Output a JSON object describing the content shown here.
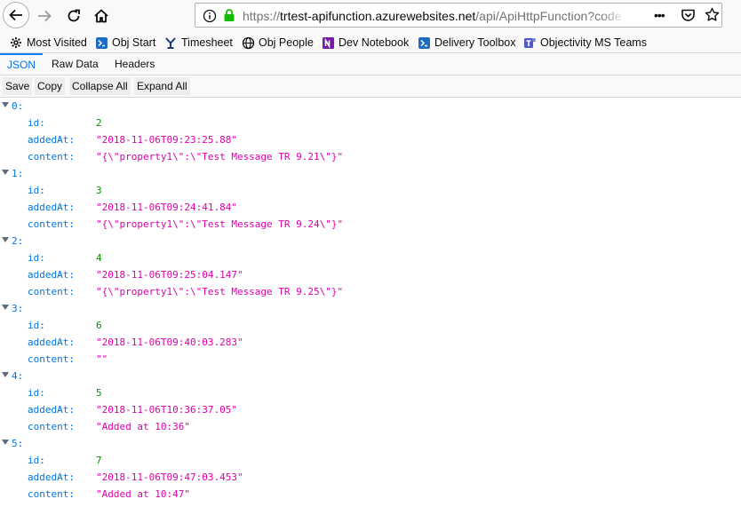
{
  "browser": {
    "url_scheme": "https://",
    "url_host": "trtest-apifunction.azurewebsites.net",
    "url_path": "/api/ApiHttpFunction?code",
    "url_menu": "•••"
  },
  "bookmarks": [
    {
      "label": "Most Visited",
      "icon": "gear-icon"
    },
    {
      "label": "Obj Start",
      "icon": "obj-start-icon"
    },
    {
      "label": "Timesheet",
      "icon": "timesheet-icon"
    },
    {
      "label": "Obj People",
      "icon": "globe-icon"
    },
    {
      "label": "Dev Notebook",
      "icon": "onenote-icon"
    },
    {
      "label": "Delivery Toolbox",
      "icon": "obj-start-icon"
    },
    {
      "label": "Objectivity MS Teams",
      "icon": "teams-icon"
    }
  ],
  "viewer": {
    "tabs": [
      "JSON",
      "Raw Data",
      "Headers"
    ],
    "toolbar": [
      "Save",
      "Copy",
      "Collapse All",
      "Expand All"
    ]
  },
  "records": [
    {
      "index": "0:",
      "id": "2",
      "addedAt": "\"2018-11-06T09:23:25.88\"",
      "content": "\"{\\\"property1\\\":\\\"Test Message TR 9.21\\\"}\""
    },
    {
      "index": "1:",
      "id": "3",
      "addedAt": "\"2018-11-06T09:24:41.84\"",
      "content": "\"{\\\"property1\\\":\\\"Test Message TR 9.24\\\"}\""
    },
    {
      "index": "2:",
      "id": "4",
      "addedAt": "\"2018-11-06T09:25:04.147\"",
      "content": "\"{\\\"property1\\\":\\\"Test Message TR 9.25\\\"}\""
    },
    {
      "index": "3:",
      "id": "6",
      "addedAt": "\"2018-11-06T09:40:03.283\"",
      "content": "\"\""
    },
    {
      "index": "4:",
      "id": "5",
      "addedAt": "\"2018-11-06T10:36:37.05\"",
      "content": "\"Added at 10:36\""
    },
    {
      "index": "5:",
      "id": "7",
      "addedAt": "\"2018-11-06T09:47:03.453\"",
      "content": "\"Added at 10:47\""
    }
  ],
  "field_keys": {
    "id": "id:",
    "addedAt": "addedAt:",
    "content": "content:"
  },
  "colors": {
    "key": "#0074e8",
    "number": "#058b00",
    "string": "#dd00a9",
    "selected_tab": "#0074e8"
  }
}
